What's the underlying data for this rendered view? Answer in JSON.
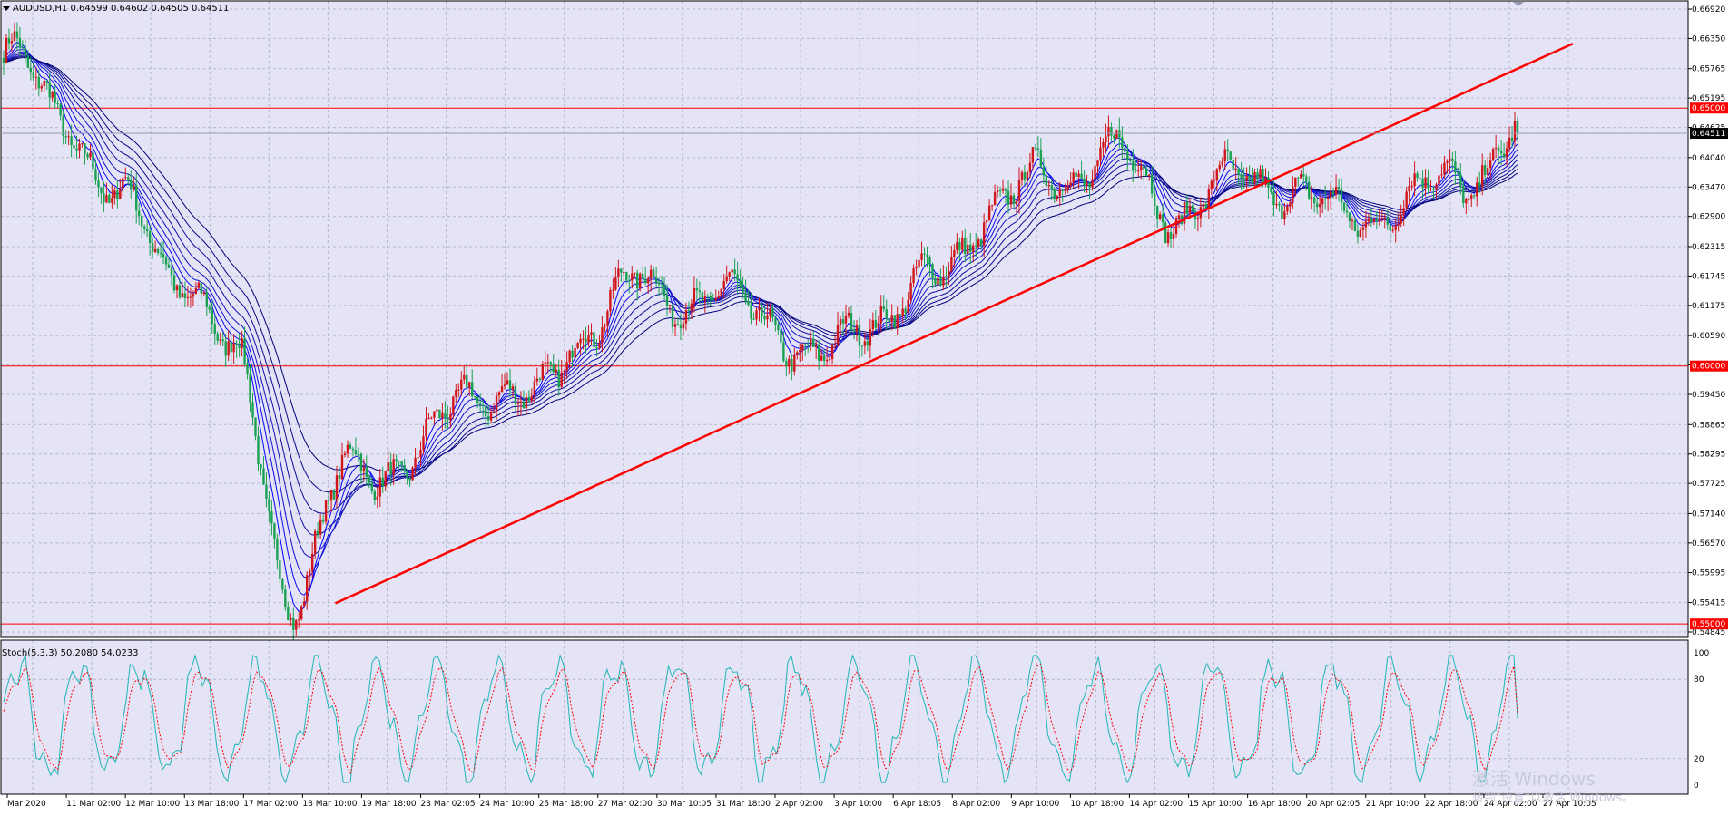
{
  "window": {
    "symbol_header": "AUDUSD,H1  0.64599 0.64602 0.64505 0.64511",
    "menu_icon": "triangle-down-icon"
  },
  "colors": {
    "background": "#e4e4f6",
    "grid": "#b7b7cc",
    "bull_candle": "#d0161a",
    "bear_candle": "#1aa152",
    "ma_fast": "#0000ff",
    "ma_slow": "#000088",
    "level_line": "#ff0000",
    "trend_line": "#ff0000",
    "stoch_main": "#23b6b6",
    "stoch_signal": "#ff0000"
  },
  "price_axis": {
    "ticks": [
      "0.66920",
      "0.66350",
      "0.65765",
      "0.65195",
      "0.64625",
      "0.64040",
      "0.63470",
      "0.62900",
      "0.62315",
      "0.61745",
      "0.61175",
      "0.60590",
      "0.60020",
      "0.59450",
      "0.58865",
      "0.58295",
      "0.57725",
      "0.57140",
      "0.56570",
      "0.55995",
      "0.55415",
      "0.54845"
    ],
    "level_labels": [
      "0.65000",
      "0.60000",
      "0.55000"
    ],
    "current_price": "0.64511"
  },
  "time_axis": {
    "labels": [
      "Mar 2020",
      "11 Mar 02:00",
      "12 Mar 10:00",
      "13 Mar 18:00",
      "17 Mar 02:00",
      "18 Mar 10:00",
      "19 Mar 18:00",
      "23 Mar 02:05",
      "24 Mar 10:00",
      "25 Mar 18:00",
      "27 Mar 02:00",
      "30 Mar 10:05",
      "31 Mar 18:00",
      "2 Apr 02:00",
      "3 Apr 10:00",
      "6 Apr 18:05",
      "8 Apr 02:00",
      "9 Apr 10:00",
      "10 Apr 18:00",
      "14 Apr 02:00",
      "15 Apr 10:00",
      "16 Apr 18:00",
      "20 Apr 02:05",
      "21 Apr 10:00",
      "22 Apr 18:00",
      "24 Apr 02:00",
      "27 Apr 10:05"
    ]
  },
  "indicator": {
    "header": "Stoch(5,3,3) 50.2080 54.0233",
    "levels": [
      "100",
      "80",
      "20",
      "0"
    ]
  },
  "watermark": {
    "line1": "激活 Windows",
    "line2": "转到\"设置\"以激活 Windows。"
  },
  "chart_data": {
    "type": "candlestick",
    "symbol": "AUDUSD",
    "timeframe": "H1",
    "ohlc_last": {
      "open": 0.64599,
      "high": 0.64602,
      "low": 0.64505,
      "close": 0.64511
    },
    "ylim": [
      0.54845,
      0.6692
    ],
    "price_path": [
      {
        "x": "Mar 2020",
        "close": 0.6605
      },
      {
        "x": "11 Mar 02:00",
        "close": 0.649
      },
      {
        "x": "12 Mar 10:00",
        "close": 0.631
      },
      {
        "x": "13 Mar 18:00",
        "close": 0.619
      },
      {
        "x": "17 Mar 02:00",
        "close": 0.6
      },
      {
        "x": "18 Mar 10:00",
        "close": 0.554
      },
      {
        "x": "19 Mar 18:00",
        "close": 0.582
      },
      {
        "x": "23 Mar 02:05",
        "close": 0.58
      },
      {
        "x": "24 Mar 10:00",
        "close": 0.597
      },
      {
        "x": "25 Mar 18:00",
        "close": 0.592
      },
      {
        "x": "27 Mar 02:00",
        "close": 0.608
      },
      {
        "x": "30 Mar 10:05",
        "close": 0.616
      },
      {
        "x": "31 Mar 18:00",
        "close": 0.613
      },
      {
        "x": "2 Apr 02:00",
        "close": 0.611
      },
      {
        "x": "3 Apr 10:00",
        "close": 0.6
      },
      {
        "x": "6 Apr 18:05",
        "close": 0.611
      },
      {
        "x": "8 Apr 02:00",
        "close": 0.616
      },
      {
        "x": "9 Apr 10:00",
        "close": 0.632
      },
      {
        "x": "10 Apr 18:00",
        "close": 0.636
      },
      {
        "x": "14 Apr 02:00",
        "close": 0.642
      },
      {
        "x": "15 Apr 10:00",
        "close": 0.63
      },
      {
        "x": "16 Apr 18:00",
        "close": 0.635
      },
      {
        "x": "20 Apr 02:05",
        "close": 0.636
      },
      {
        "x": "21 Apr 10:00",
        "close": 0.628
      },
      {
        "x": "22 Apr 18:00",
        "close": 0.632
      },
      {
        "x": "24 Apr 02:00",
        "close": 0.636
      },
      {
        "x": "27 Apr 10:05",
        "close": 0.6451
      }
    ],
    "horizontal_levels": [
      0.65,
      0.6,
      0.55
    ],
    "trendline": {
      "start": {
        "x": "18 Mar 10:00",
        "y": 0.554
      },
      "end": {
        "x": "27 Apr 10:05",
        "y": 0.6625
      }
    },
    "moving_averages": "ribbon of 8 moving averages (blue to dark navy)",
    "stochastic": {
      "params": "5,3,3",
      "main": 50.208,
      "signal": 54.0233,
      "levels": [
        20,
        80
      ],
      "ylim": [
        0,
        100
      ]
    }
  }
}
